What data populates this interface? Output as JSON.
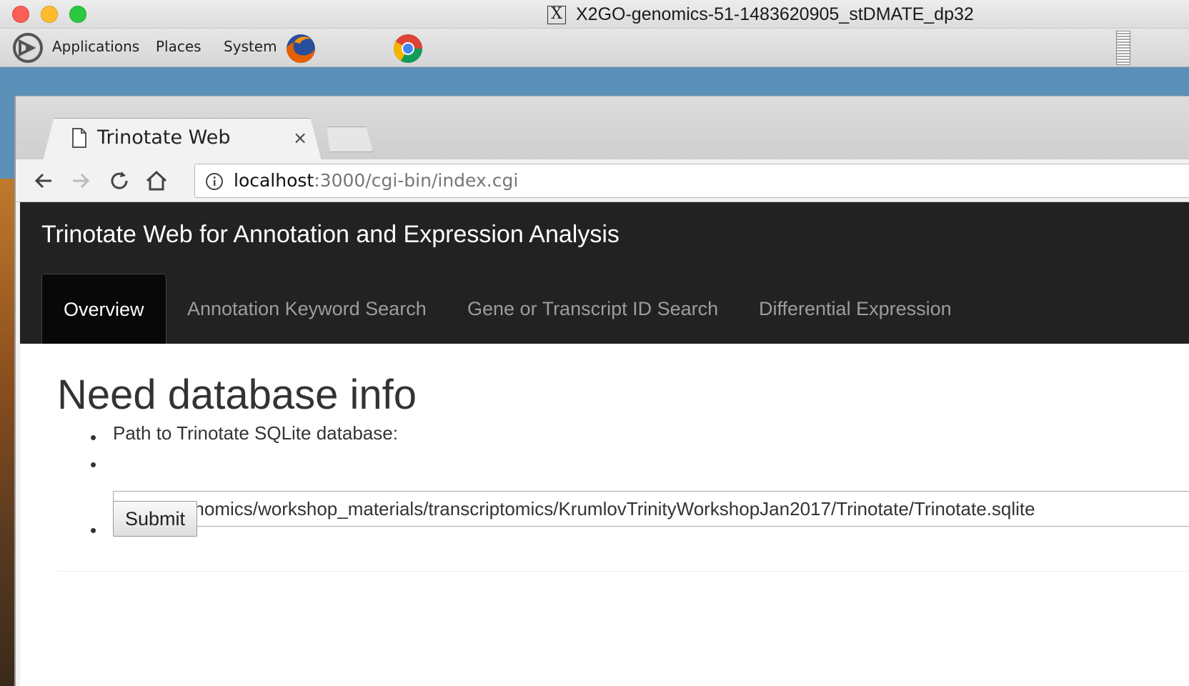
{
  "window": {
    "title": "X2GO-genomics-51-1483620905_stDMATE_dp32"
  },
  "panel": {
    "items": [
      "Applications",
      "Places",
      "System"
    ],
    "launchers": [
      "firefox-icon",
      "chrome-icon"
    ]
  },
  "browser": {
    "tab_title": "Trinotate Web",
    "tab_close": "×",
    "url_host": "localhost",
    "url_path": ":3000/cgi-bin/index.cgi"
  },
  "site": {
    "brand": "Trinotate Web for Annotation and Expression Analysis",
    "nav": [
      {
        "label": "Overview",
        "active": true
      },
      {
        "label": "Annotation Keyword Search",
        "active": false
      },
      {
        "label": "Gene or Transcript ID Search",
        "active": false
      },
      {
        "label": "Differential Expression",
        "active": false
      }
    ]
  },
  "main": {
    "heading": "Need database info",
    "path_label": "Path to Trinotate SQLite database:",
    "db_path_value": "/home/genomics/workshop_materials/transcriptomics/KrumlovTrinityWorkshopJan2017/Trinotate/Trinotate.sqlite",
    "submit_label": "Submit",
    "bullet": "•"
  },
  "colors": {
    "navbar_bg": "#222222",
    "active_tab_bg": "#080808",
    "desktop_blue": "#5a8fb8"
  }
}
